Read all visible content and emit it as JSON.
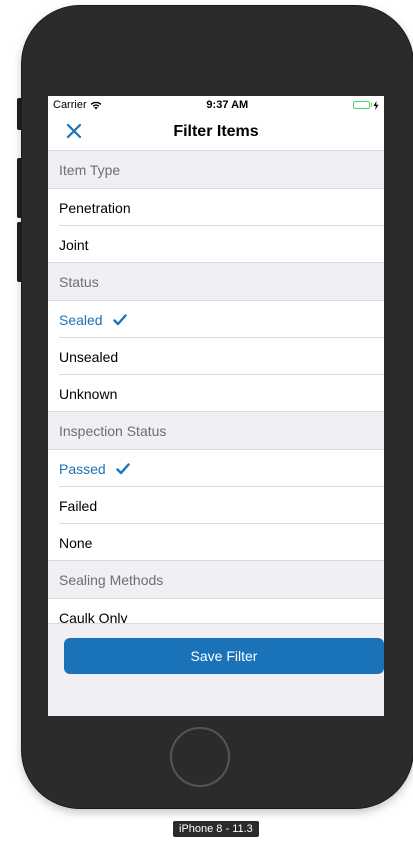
{
  "status_bar": {
    "carrier": "Carrier",
    "time": "9:37 AM"
  },
  "nav": {
    "title": "Filter Items"
  },
  "sections": [
    {
      "header": "Item Type",
      "items": [
        {
          "label": "Penetration",
          "selected": false
        },
        {
          "label": "Joint",
          "selected": false
        }
      ]
    },
    {
      "header": "Status",
      "items": [
        {
          "label": "Sealed",
          "selected": true
        },
        {
          "label": "Unsealed",
          "selected": false
        },
        {
          "label": "Unknown",
          "selected": false
        }
      ]
    },
    {
      "header": "Inspection Status",
      "items": [
        {
          "label": "Passed",
          "selected": true
        },
        {
          "label": "Failed",
          "selected": false
        },
        {
          "label": "None",
          "selected": false
        }
      ]
    },
    {
      "header": "Sealing Methods",
      "items": [
        {
          "label": "Caulk Only",
          "selected": false
        }
      ]
    }
  ],
  "footer": {
    "save_label": "Save Filter"
  },
  "device": {
    "label": "iPhone 8 - 11.3"
  },
  "colors": {
    "accent": "#1a73b8",
    "battery": "#4cd964",
    "background": "#efeff4"
  }
}
